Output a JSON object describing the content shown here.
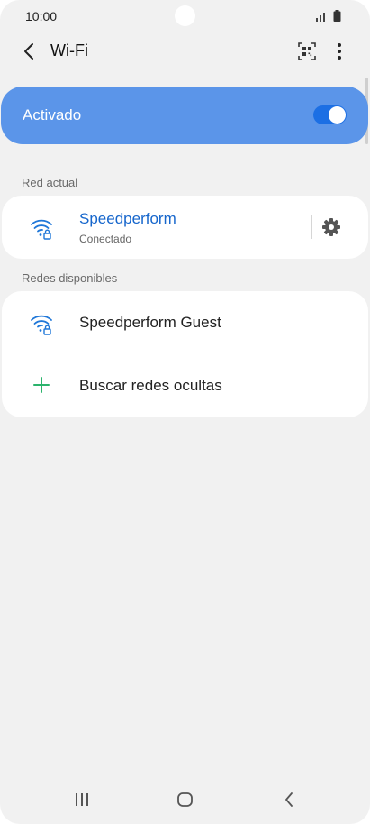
{
  "status_bar": {
    "time": "10:00"
  },
  "header": {
    "title": "Wi-Fi"
  },
  "toggle": {
    "label": "Activado",
    "on": true
  },
  "current_network": {
    "section_label": "Red actual",
    "name": "Speedperform",
    "status": "Conectado"
  },
  "available": {
    "section_label": "Redes disponibles",
    "networks": [
      {
        "name": "Speedperform Guest"
      }
    ],
    "add_hidden_label": "Buscar redes ocultas"
  },
  "colors": {
    "accent": "#5b95e9",
    "active_text": "#1666cc",
    "plus": "#2bb36c"
  },
  "icons": [
    "back-icon",
    "qr-scan-icon",
    "more-icon",
    "wifi-lock-icon",
    "gear-icon",
    "plus-icon",
    "recent-apps-icon",
    "home-icon",
    "nav-back-icon",
    "signal-icon",
    "battery-icon"
  ]
}
